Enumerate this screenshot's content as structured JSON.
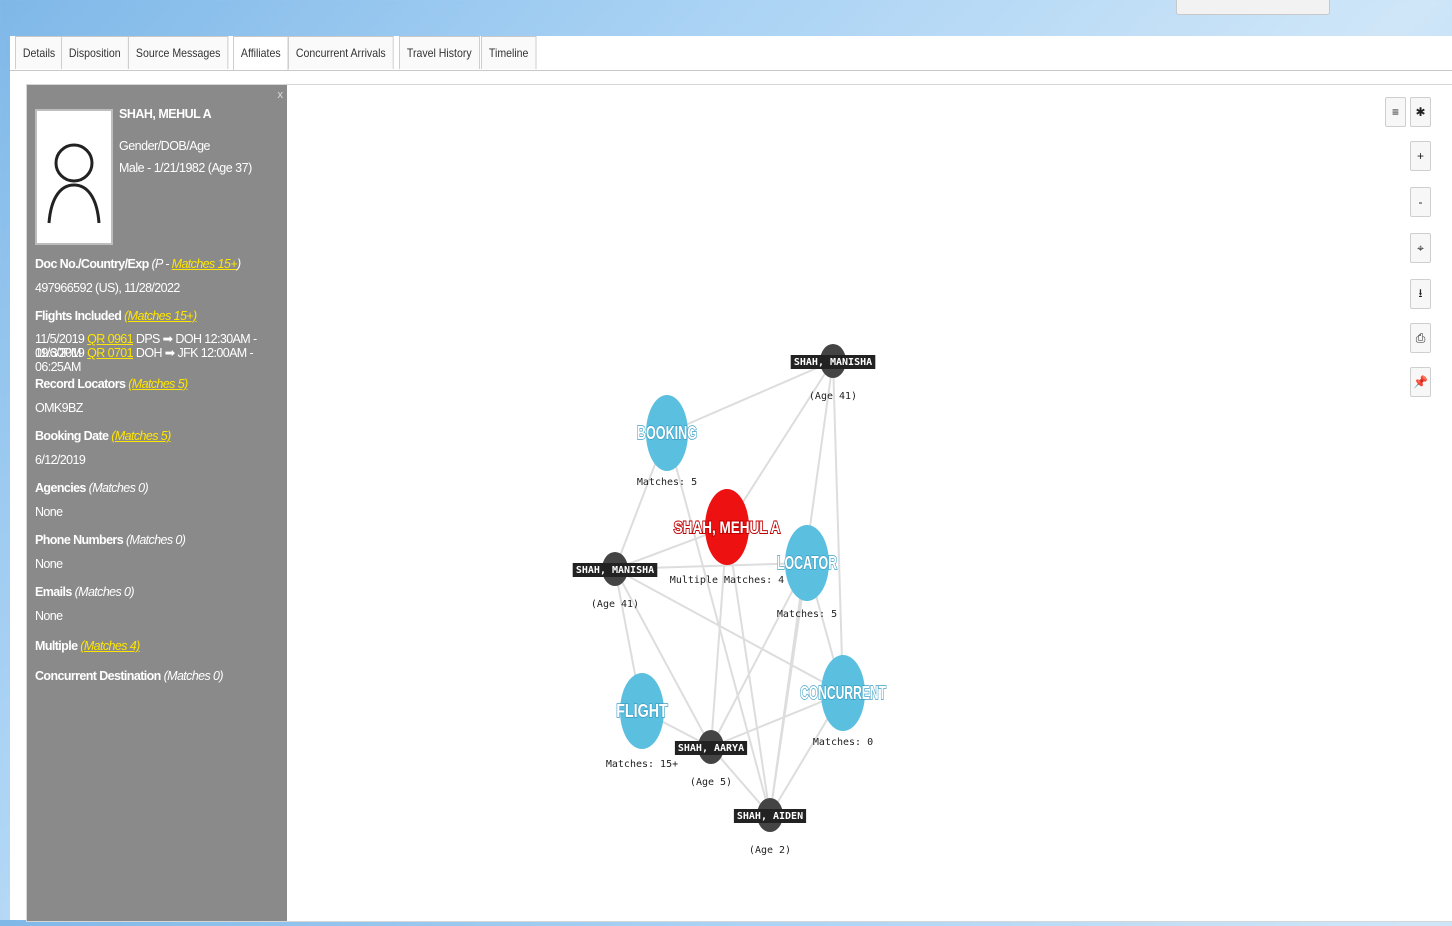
{
  "tabs": [
    "Details",
    "Disposition",
    "Source Messages",
    "Affiliates",
    "Concurrent Arrivals",
    "Travel History",
    "Timeline"
  ],
  "active_tab": "Affiliates",
  "panel": {
    "close": "x",
    "name": "SHAH, MEHUL A",
    "gender_dob_label": "Gender/DOB/Age",
    "gender_dob_value": "Male - 1/21/1982 (Age 37)",
    "doc_label": "Doc No./Country/Exp",
    "doc_prefix": "(P - ",
    "doc_matches": "Matches 15+",
    "doc_suffix": ")",
    "doc_value": "497966592 (US), 11/28/2022",
    "flights_label": "Flights Included",
    "flights_matches": "(Matches 15+)",
    "flight1_date": "11/5/2019",
    "flight1_no": "QR 0961",
    "flight1_route": "DPS ➡ DOH 12:30AM - 09:30PM",
    "flight2_date": "11/6/2019",
    "flight2_no": "QR 0701",
    "flight2_route": "DOH ➡ JFK 12:00AM - 06:25AM",
    "locators_label": "Record Locators",
    "locators_matches": "(Matches 5)",
    "locators_value": "OMK9BZ",
    "booking_label": "Booking Date",
    "booking_matches": "(Matches 5)",
    "booking_value": "6/12/2019",
    "agencies_label": "Agencies",
    "agencies_matches": "(Matches 0)",
    "agencies_value": "None",
    "phones_label": "Phone Numbers",
    "phones_matches": "(Matches 0)",
    "phones_value": "None",
    "emails_label": "Emails",
    "emails_matches": "(Matches 0)",
    "emails_value": "None",
    "multiple_label": "Multiple",
    "multiple_matches": "(Matches 4)",
    "concurrent_label": "Concurrent Destination",
    "concurrent_matches": "(Matches 0)"
  },
  "toolbar": {
    "menu": "≡",
    "settings": "✱",
    "zoom_in": "+",
    "zoom_out": "-",
    "center": "⌖",
    "download": "⭳",
    "print": "⎙",
    "pin": "📌"
  },
  "graph": {
    "nodes": [
      {
        "id": "mehul",
        "label": "SHAH, MEHUL A",
        "sub": "Multiple Matches: 4",
        "kind": "subject"
      },
      {
        "id": "booking",
        "label": "BOOKING",
        "sub": "Matches: 5",
        "kind": "category"
      },
      {
        "id": "locator",
        "label": "LOCATOR",
        "sub": "Matches: 5",
        "kind": "category"
      },
      {
        "id": "concurrent",
        "label": "CONCURRENT",
        "sub": "Matches: 0",
        "kind": "category"
      },
      {
        "id": "flight",
        "label": "FLIGHT",
        "sub": "Matches: 15+",
        "kind": "category"
      },
      {
        "id": "manisha1",
        "label": "SHAH, MANISHA",
        "sub": "(Age 41)",
        "kind": "person"
      },
      {
        "id": "manisha2",
        "label": "SHAH, MANISHA",
        "sub": "(Age 41)",
        "kind": "person"
      },
      {
        "id": "aarya",
        "label": "SHAH, AARYA",
        "sub": "(Age 5)",
        "kind": "person"
      },
      {
        "id": "aiden",
        "label": "SHAH, AIDEN",
        "sub": "(Age 2)",
        "kind": "person"
      }
    ],
    "edges": [
      [
        "booking",
        "manisha1"
      ],
      [
        "booking",
        "manisha2"
      ],
      [
        "booking",
        "aiden"
      ],
      [
        "manisha1",
        "mehul"
      ],
      [
        "manisha1",
        "concurrent"
      ],
      [
        "manisha1",
        "aiden"
      ],
      [
        "manisha2",
        "mehul"
      ],
      [
        "manisha2",
        "locator"
      ],
      [
        "manisha2",
        "flight"
      ],
      [
        "manisha2",
        "concurrent"
      ],
      [
        "manisha2",
        "aarya"
      ],
      [
        "mehul",
        "aarya"
      ],
      [
        "mehul",
        "aiden"
      ],
      [
        "locator",
        "aarya"
      ],
      [
        "locator",
        "aiden"
      ],
      [
        "locator",
        "concurrent"
      ],
      [
        "flight",
        "aarya"
      ],
      [
        "aarya",
        "concurrent"
      ],
      [
        "aarya",
        "aiden"
      ],
      [
        "concurrent",
        "aiden"
      ]
    ],
    "colors": {
      "subject": "#ee1111",
      "category": "#5bbfdf",
      "person": "#444444",
      "edge": "#dddddd"
    }
  }
}
